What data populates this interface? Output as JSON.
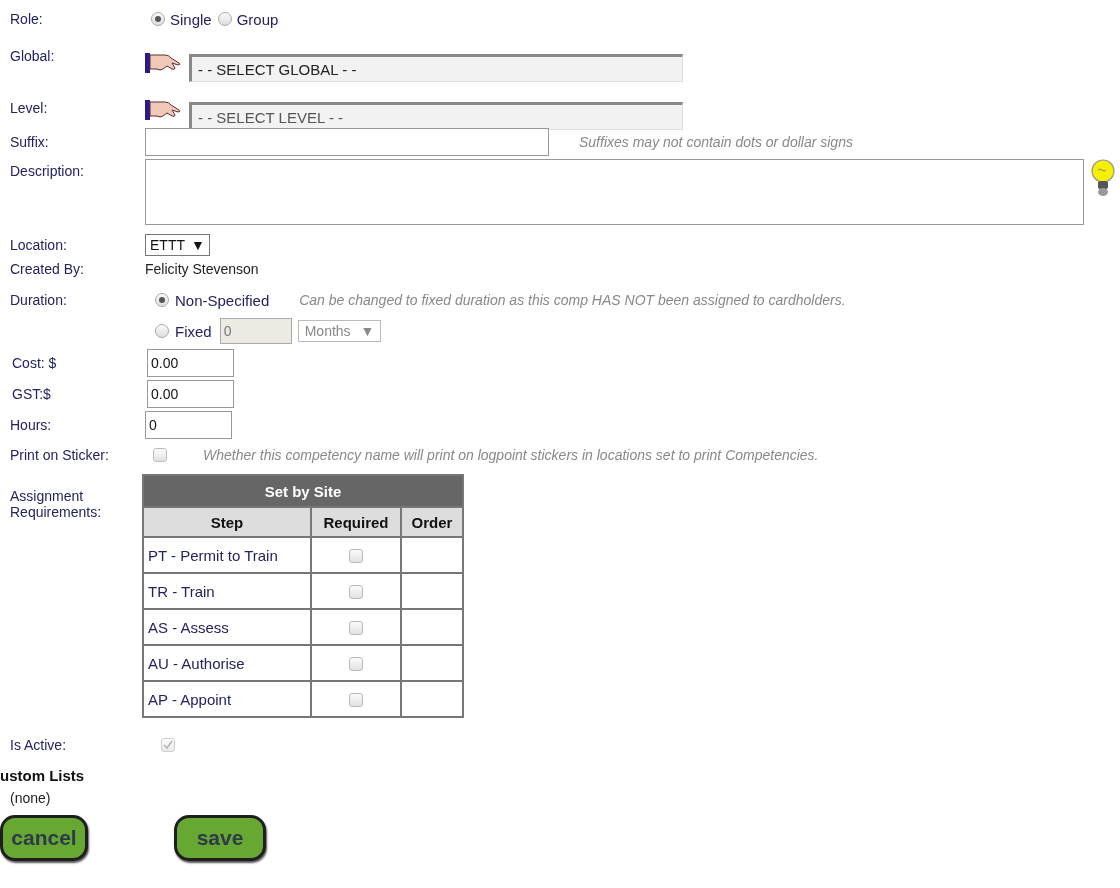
{
  "role": {
    "label": "Role:",
    "options": [
      {
        "label": "Single",
        "selected": true
      },
      {
        "label": "Group",
        "selected": false
      }
    ]
  },
  "global": {
    "label": "Global:",
    "value": "- - SELECT GLOBAL - -"
  },
  "level": {
    "label": "Level:",
    "value": "- - SELECT LEVEL - -"
  },
  "suffix": {
    "label": "Suffix:",
    "hint": "Suffixes may not contain dots or dollar signs"
  },
  "description": {
    "label": "Description:"
  },
  "location": {
    "label": "Location:",
    "value": "ETTT",
    "arrow": "▼"
  },
  "created_by": {
    "label": "Created By:",
    "value": "Felicity Stevenson"
  },
  "duration": {
    "label": "Duration:",
    "options": [
      {
        "label": "Non-Specified",
        "selected": true
      },
      {
        "label": "Fixed",
        "selected": false
      }
    ],
    "hint": "Can be changed to fixed duration as this comp HAS NOT been assigned to cardholders.",
    "fixed_value": "0",
    "unit": "Months",
    "unit_arrow": "▼",
    "disabled": true
  },
  "cost": {
    "label": "Cost: $",
    "value": "0.00"
  },
  "gst": {
    "label": "GST:$",
    "value": "0.00"
  },
  "hours": {
    "label": "Hours:",
    "value": "0"
  },
  "print_on_sticker": {
    "label": "Print on Sticker:",
    "checked": false,
    "hint": "Whether this competency name will print on logpoint stickers in locations set to print Competencies."
  },
  "assignment": {
    "label": "Assignment Requirements:",
    "caption": "Set by Site",
    "columns": [
      "Step",
      "Required",
      "Order"
    ],
    "rows": [
      {
        "step": "PT - Permit to Train",
        "required": false
      },
      {
        "step": "TR - Train",
        "required": false
      },
      {
        "step": "AS - Assess",
        "required": false
      },
      {
        "step": "AU - Authorise",
        "required": false
      },
      {
        "step": "AP - Appoint",
        "required": false
      }
    ]
  },
  "is_active": {
    "label": "Is Active:",
    "checked": true,
    "disabled": true
  },
  "custom_lists": {
    "title": "ustom Lists",
    "value": "(none)"
  },
  "buttons": [
    {
      "label": "cancel"
    },
    {
      "label": "save"
    }
  ]
}
